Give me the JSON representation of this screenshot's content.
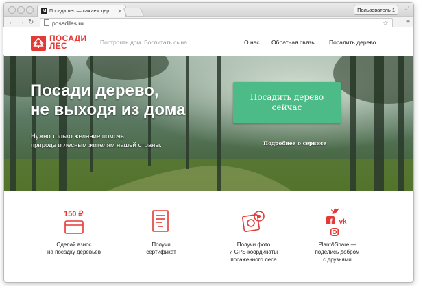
{
  "browser": {
    "tab_title": "Посади лес — сажаем дер",
    "tab_favicon": "М",
    "profile_button": "Пользователь 1",
    "url": "posadiles.ru"
  },
  "site": {
    "logo_line1": "ПОСАДИ",
    "logo_line2": "ЛЕС",
    "tagline": "Построить дом. Воспитать сына...",
    "nav": [
      "О нас",
      "Обратная связь",
      "Посадить дерево"
    ]
  },
  "hero": {
    "heading_line1": "Посади дерево,",
    "heading_line2": "не выходя из дома",
    "sub_line1": "Нужно только желание помочь",
    "sub_line2": "природе и лесным жителям нашей страны.",
    "cta_line1": "Посадить дерево",
    "cta_line2": "сейчас",
    "more_link": "Подробнее о сервисе"
  },
  "features": [
    {
      "icon": "card-icon",
      "price": "150 ₽",
      "line1": "Сделай взнос",
      "line2": "на посадку деревьев",
      "line3": ""
    },
    {
      "icon": "certificate-icon",
      "line1": "Получи",
      "line2": "сертификат",
      "line3": ""
    },
    {
      "icon": "photo-gps-icon",
      "line1": "Получи фото",
      "line2": "и GPS-координаты",
      "line3": "посаженного леса"
    },
    {
      "icon": "social-icons",
      "line1": "Plant&Share —",
      "line2": "поделись добром",
      "line3": "с друзьями"
    }
  ],
  "colors": {
    "brand": "#e53935",
    "cta": "#4dbb87"
  }
}
